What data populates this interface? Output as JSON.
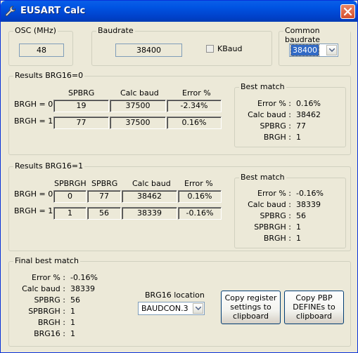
{
  "window": {
    "title": "EUSART Calc"
  },
  "osc": {
    "label": "OSC (MHz)",
    "value": "48"
  },
  "baudrate": {
    "label": "Baudrate",
    "value": "38400",
    "kbaud_label": "KBaud",
    "kbaud_checked": false
  },
  "common": {
    "label": "Common baudrate",
    "value": "38400"
  },
  "brg16_0": {
    "label": "Results BRG16=0",
    "headers": {
      "spbrg": "SPBRG",
      "calc": "Calc baud",
      "error": "Error %"
    },
    "rows": [
      {
        "label": "BRGH = 0",
        "spbrg": "19",
        "calc": "37500",
        "error": "-2.34%"
      },
      {
        "label": "BRGH = 1",
        "spbrg": "77",
        "calc": "37500",
        "error": "0.16%"
      }
    ],
    "best": {
      "label": "Best match",
      "lines": [
        {
          "k": "Error % :",
          "v": "0.16%"
        },
        {
          "k": "Calc baud :",
          "v": "38462"
        },
        {
          "k": "SPBRG :",
          "v": "77"
        },
        {
          "k": "BRGH :",
          "v": "1"
        }
      ]
    }
  },
  "brg16_1": {
    "label": "Results BRG16=1",
    "headers": {
      "spbrgh": "SPBRGH",
      "spbrg": "SPBRG",
      "calc": "Calc baud",
      "error": "Error %"
    },
    "rows": [
      {
        "label": "BRGH = 0",
        "spbrgh": "0",
        "spbrg": "77",
        "calc": "38462",
        "error": "0.16%"
      },
      {
        "label": "BRGH = 1",
        "spbrgh": "1",
        "spbrg": "56",
        "calc": "38339",
        "error": "-0.16%"
      }
    ],
    "best": {
      "label": "Best match",
      "lines": [
        {
          "k": "Error % :",
          "v": "-0.16%"
        },
        {
          "k": "Calc baud :",
          "v": "38339"
        },
        {
          "k": "SPBRG :",
          "v": "56"
        },
        {
          "k": "SPBRGH :",
          "v": "1"
        },
        {
          "k": "BRGH :",
          "v": "1"
        }
      ]
    }
  },
  "final": {
    "label": "Final best match",
    "lines": [
      {
        "k": "Error % :",
        "v": "-0.16%"
      },
      {
        "k": "Calc baud :",
        "v": "38339"
      },
      {
        "k": "SPBRG :",
        "v": "56"
      },
      {
        "k": "SPBRGH :",
        "v": "1"
      },
      {
        "k": "BRGH :",
        "v": "1"
      },
      {
        "k": "BRG16 :",
        "v": "1"
      }
    ],
    "brg16_location_label": "BRG16 location",
    "brg16_location_value": "BAUDCON.3",
    "copy_register_label": "Copy register settings to clipboard",
    "copy_pbp_label": "Copy PBP DEFINEs to clipboard"
  },
  "icons": {
    "app": "wrench-icon",
    "close": "close-icon",
    "dropdown": "chevron-down-icon"
  },
  "colors": {
    "titlebar": "#0054e3",
    "face": "#ece9d8",
    "close": "#d5502e",
    "selection": "#316ac5"
  }
}
